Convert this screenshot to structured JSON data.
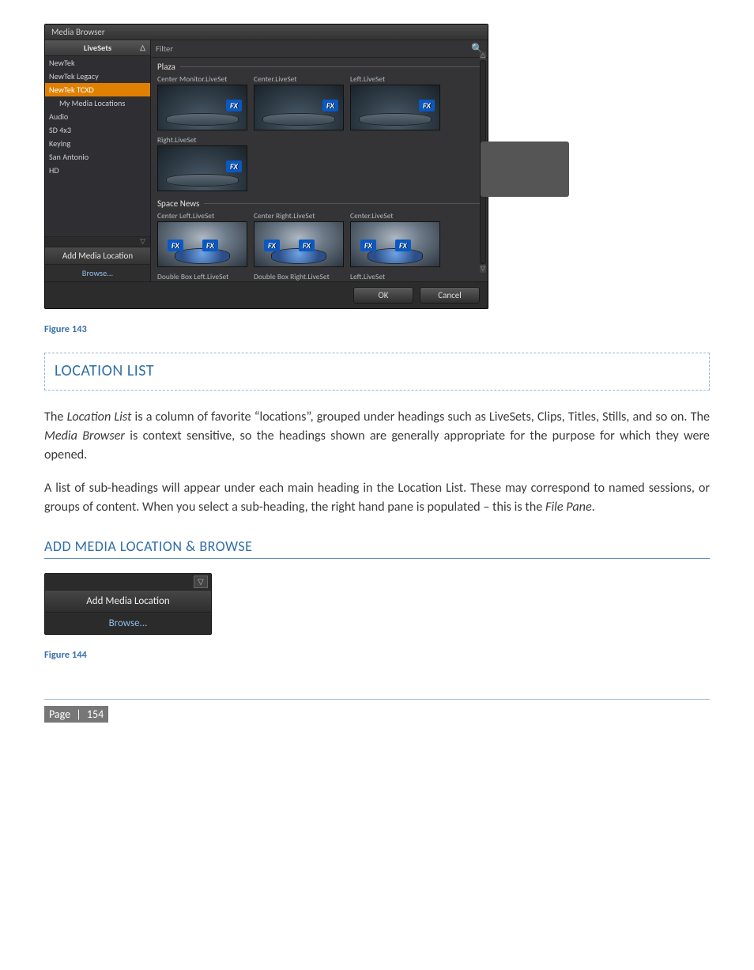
{
  "media_browser": {
    "title": "Media Browser",
    "sidebar": {
      "heading": "LiveSets",
      "items": [
        {
          "label": "NewTek",
          "selected": false,
          "indent": false
        },
        {
          "label": "NewTek Legacy",
          "selected": false,
          "indent": false
        },
        {
          "label": "NewTek TCXD",
          "selected": true,
          "indent": false
        },
        {
          "label": "My Media Locations",
          "selected": false,
          "indent": true
        },
        {
          "label": "Audio",
          "selected": false,
          "indent": false
        },
        {
          "label": "SD 4x3",
          "selected": false,
          "indent": false
        },
        {
          "label": "Keying",
          "selected": false,
          "indent": false
        },
        {
          "label": "San Antonio",
          "selected": false,
          "indent": false
        },
        {
          "label": "HD",
          "selected": false,
          "indent": false
        }
      ],
      "add_label": "Add Media Location",
      "browse_label": "Browse..."
    },
    "filter_label": "Filter",
    "groups": [
      {
        "name": "Plaza",
        "thumbs": [
          {
            "label": "Center Monitor.LiveSet",
            "badges": [
              "FX"
            ],
            "style": "plaza"
          },
          {
            "label": "Center.LiveSet",
            "badges": [
              "FX"
            ],
            "style": "plaza"
          },
          {
            "label": "Left.LiveSet",
            "badges": [
              "FX"
            ],
            "style": "plaza"
          },
          {
            "label": "Right.LiveSet",
            "badges": [
              "FX"
            ],
            "style": "plaza"
          }
        ]
      },
      {
        "name": "Space News",
        "thumbs": [
          {
            "label": "Center Left.LiveSet",
            "badges": [
              "FX",
              "FX"
            ],
            "style": "space"
          },
          {
            "label": "Center Right.LiveSet",
            "badges": [
              "FX",
              "FX"
            ],
            "style": "space"
          },
          {
            "label": "Center.LiveSet",
            "badges": [
              "FX",
              "FX"
            ],
            "style": "space"
          },
          {
            "label": "Double Box Left.LiveSet",
            "badges": [],
            "style": "space",
            "clipped": true
          },
          {
            "label": "Double Box Right.LiveSet",
            "badges": [],
            "style": "space",
            "clipped": true
          },
          {
            "label": "Left.LiveSet",
            "badges": [],
            "style": "space",
            "clipped": true
          }
        ]
      }
    ],
    "ok_label": "OK",
    "cancel_label": "Cancel",
    "fx_badge": "FX"
  },
  "figure143": "Figure 143",
  "heading_location_list": "LOCATION LIST",
  "para1_pre": "The ",
  "para1_em1": "Location List",
  "para1_mid": " is a column of favorite “locations”, grouped under headings such as LiveSets, Clips, Titles, Stills, and so on.  The ",
  "para1_em2": "Media Browser",
  "para1_post": " is context sensitive, so the headings shown are generally appropriate for the purpose for which they were opened.",
  "para2_pre": "A list of sub-headings will appear under each main heading in the Location List.  These may correspond to named sessions, or groups of content.  When you select a sub-heading, the right hand pane is populated – this is the ",
  "para2_em": "File Pane",
  "para2_post": ".",
  "heading_add_media": "ADD MEDIA LOCATION & BROWSE",
  "add_panel": {
    "add_label": "Add Media Location",
    "browse_label": "Browse..."
  },
  "figure144": "Figure 144",
  "footer": {
    "page_word": "Page",
    "sep": "|",
    "num": "154"
  }
}
